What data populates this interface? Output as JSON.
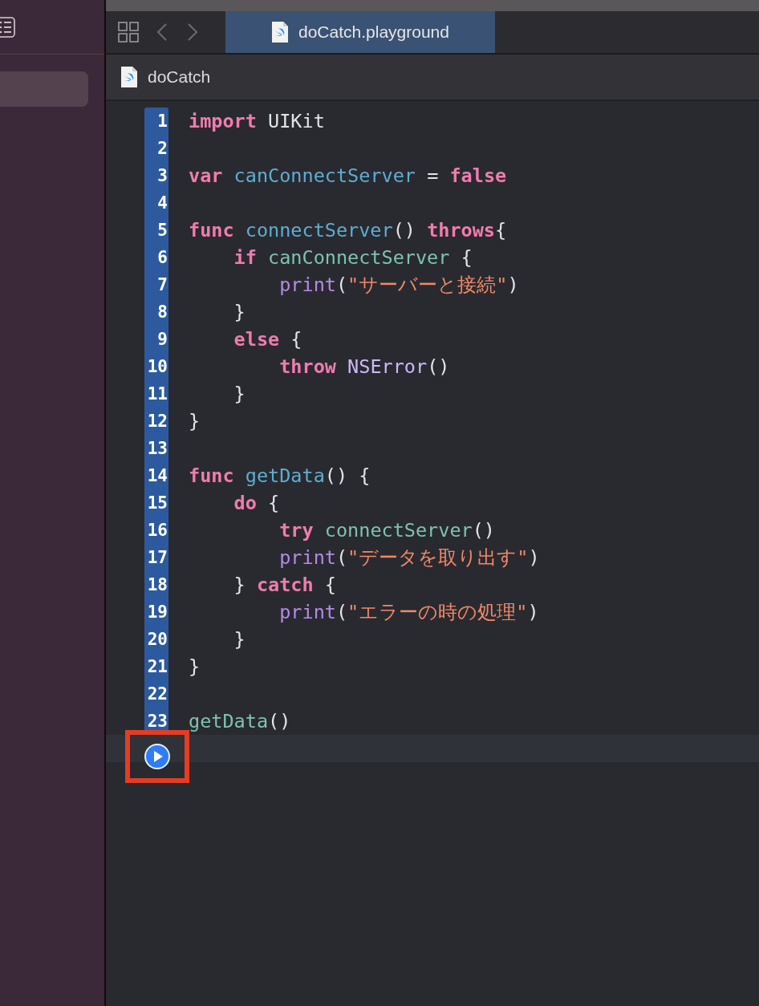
{
  "tab_bar": {
    "tabs": [
      {
        "label": "doCatch.playground",
        "selected": true
      }
    ]
  },
  "breadcrumb": {
    "label": "doCatch"
  },
  "editor": {
    "lines": [
      {
        "number": "1",
        "tokens": [
          {
            "text": "import",
            "kind": "keyword"
          },
          {
            "text": " UIKit",
            "kind": "plain"
          }
        ]
      },
      {
        "number": "2"
      },
      {
        "number": "3",
        "tokens": [
          {
            "text": "var",
            "kind": "keyword"
          },
          {
            "text": " canConnectServer",
            "kind": "decl"
          },
          {
            "text": " = ",
            "kind": "plain"
          },
          {
            "text": "false",
            "kind": "keyword"
          }
        ]
      },
      {
        "number": "4"
      },
      {
        "number": "5",
        "tokens": [
          {
            "text": "func",
            "kind": "keyword"
          },
          {
            "text": " connectServer",
            "kind": "decl"
          },
          {
            "text": "() ",
            "kind": "plain"
          },
          {
            "text": "throws",
            "kind": "keyword"
          },
          {
            "text": "{",
            "kind": "plain"
          }
        ]
      },
      {
        "number": "6",
        "tokens": [
          {
            "text": "    if",
            "kind": "keyword"
          },
          {
            "text": " canConnectServer",
            "kind": "ident"
          },
          {
            "text": " {",
            "kind": "plain"
          }
        ]
      },
      {
        "number": "7",
        "tokens": [
          {
            "text": "        print",
            "kind": "func"
          },
          {
            "text": "(",
            "kind": "plain"
          },
          {
            "text": "\"サーバーと接続\"",
            "kind": "string"
          },
          {
            "text": ")",
            "kind": "plain"
          }
        ]
      },
      {
        "number": "8",
        "tokens": [
          {
            "text": "    }",
            "kind": "plain"
          }
        ]
      },
      {
        "number": "9",
        "tokens": [
          {
            "text": "    else",
            "kind": "keyword"
          },
          {
            "text": " {",
            "kind": "plain"
          }
        ]
      },
      {
        "number": "10",
        "tokens": [
          {
            "text": "        throw",
            "kind": "keyword"
          },
          {
            "text": " NSError",
            "kind": "type"
          },
          {
            "text": "()",
            "kind": "plain"
          }
        ]
      },
      {
        "number": "11",
        "tokens": [
          {
            "text": "    }",
            "kind": "plain"
          }
        ]
      },
      {
        "number": "12",
        "tokens": [
          {
            "text": "}",
            "kind": "plain"
          }
        ]
      },
      {
        "number": "13"
      },
      {
        "number": "14",
        "tokens": [
          {
            "text": "func",
            "kind": "keyword"
          },
          {
            "text": " getData",
            "kind": "decl"
          },
          {
            "text": "() {",
            "kind": "plain"
          }
        ]
      },
      {
        "number": "15",
        "tokens": [
          {
            "text": "    do",
            "kind": "keyword"
          },
          {
            "text": " {",
            "kind": "plain"
          }
        ]
      },
      {
        "number": "16",
        "tokens": [
          {
            "text": "        try",
            "kind": "keyword"
          },
          {
            "text": " connectServer",
            "kind": "ident"
          },
          {
            "text": "()",
            "kind": "plain"
          }
        ]
      },
      {
        "number": "17",
        "tokens": [
          {
            "text": "        print",
            "kind": "func"
          },
          {
            "text": "(",
            "kind": "plain"
          },
          {
            "text": "\"データを取り出す\"",
            "kind": "string"
          },
          {
            "text": ")",
            "kind": "plain"
          }
        ]
      },
      {
        "number": "18",
        "tokens": [
          {
            "text": "    } ",
            "kind": "plain"
          },
          {
            "text": "catch",
            "kind": "keyword"
          },
          {
            "text": " {",
            "kind": "plain"
          }
        ]
      },
      {
        "number": "19",
        "tokens": [
          {
            "text": "        print",
            "kind": "func"
          },
          {
            "text": "(",
            "kind": "plain"
          },
          {
            "text": "\"エラーの時の処理\"",
            "kind": "string"
          },
          {
            "text": ")",
            "kind": "plain"
          }
        ]
      },
      {
        "number": "20",
        "tokens": [
          {
            "text": "    }",
            "kind": "plain"
          }
        ]
      },
      {
        "number": "21",
        "tokens": [
          {
            "text": "}",
            "kind": "plain"
          }
        ]
      },
      {
        "number": "22"
      },
      {
        "number": "23",
        "tokens": [
          {
            "text": "getData",
            "kind": "ident"
          },
          {
            "text": "()",
            "kind": "plain"
          }
        ]
      }
    ]
  }
}
